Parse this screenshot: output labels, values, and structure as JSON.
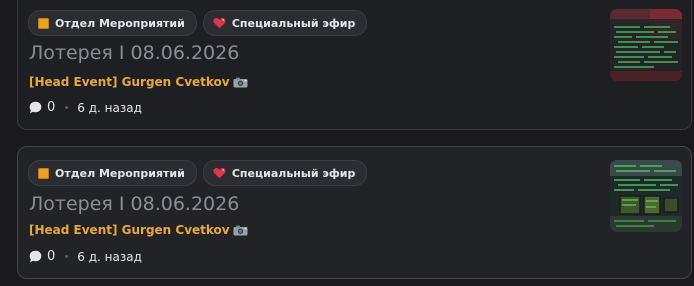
{
  "posts": [
    {
      "tags": [
        {
          "label": "Отдел Мероприятий",
          "icon": "orange-square-icon",
          "color": "#f0a020"
        },
        {
          "label": "Специальный эфир",
          "icon": "heart-icon",
          "color": "#e0364a"
        }
      ],
      "title": "Лотерея I 08.06.2026",
      "author": "[Head Event] Gurgen Cvetkov",
      "author_color": "#e9a93a",
      "author_badge": "camera-icon",
      "comment_count": "0",
      "time_ago": "6 д. назад"
    },
    {
      "tags": [
        {
          "label": "Отдел Мероприятий",
          "icon": "orange-square-icon",
          "color": "#f0a020"
        },
        {
          "label": "Специальный эфир",
          "icon": "heart-icon",
          "color": "#e0364a"
        }
      ],
      "title": "Лотерея I 08.06.2026",
      "author": "[Head Event] Gurgen Cvetkov",
      "author_color": "#e9a93a",
      "author_badge": "camera-icon",
      "comment_count": "0",
      "time_ago": "6 д. назад"
    }
  ]
}
